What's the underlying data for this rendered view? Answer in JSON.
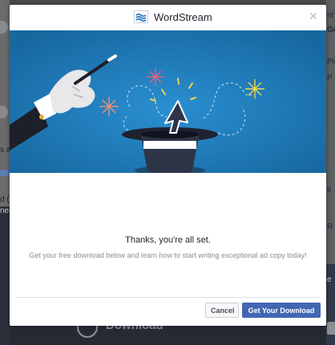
{
  "background": {
    "left_texts": [
      "s a",
      "d (i",
      "ner"
    ],
    "right_texts": [
      "nt",
      "Go",
      "Pict",
      "P",
      "ti",
      "R",
      "e"
    ],
    "download_label": "Download"
  },
  "modal": {
    "brand": "WordStream",
    "close_icon": "close-icon",
    "title": "Thanks, you're all set.",
    "subtitle": "Get your free download below and learn how to start writing exceptional ad copy today!",
    "cancel_label": "Cancel",
    "primary_label": "Get Your Download"
  },
  "colors": {
    "hero_bg": "#1c78b8",
    "primary": "#4267b2",
    "overlay": "#4a4b4d"
  }
}
